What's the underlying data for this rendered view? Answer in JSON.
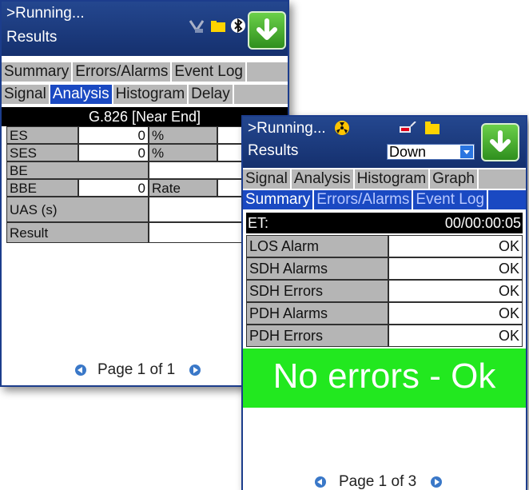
{
  "screen1": {
    "status": ">Running...",
    "title": "Results",
    "tabs_row1": [
      "Summary",
      "Errors/Alarms",
      "Event Log"
    ],
    "tabs_row2": [
      "Signal",
      "Analysis",
      "Histogram",
      "Delay"
    ],
    "active_tab": "Analysis",
    "table_title": "G.826 [Near End]",
    "rows": {
      "es": {
        "label": "ES",
        "value": "0",
        "unit": "%"
      },
      "ses": {
        "label": "SES",
        "value": "0",
        "unit": "%"
      },
      "be": {
        "label": "BE"
      },
      "bbe": {
        "label": "BBE",
        "value": "0",
        "unit": "Rate"
      },
      "uas": {
        "label": "UAS (s)"
      },
      "result": {
        "label": "Result"
      }
    },
    "pager": "Page 1 of 1"
  },
  "screen2": {
    "status": ">Running...",
    "title": "Results",
    "dropdown_value": "Down",
    "tabs_row1": [
      "Signal",
      "Analysis",
      "Histogram",
      "Graph"
    ],
    "tabs_row2": [
      "Summary",
      "Errors/Alarms",
      "Event Log"
    ],
    "active_tab": "Summary",
    "et_label": "ET:",
    "et_value": "00/00:00:05",
    "rows": [
      {
        "label": "LOS Alarm",
        "status": "OK"
      },
      {
        "label": "SDH Alarms",
        "status": "OK"
      },
      {
        "label": "SDH Errors",
        "status": "OK"
      },
      {
        "label": "PDH Alarms",
        "status": "OK"
      },
      {
        "label": "PDH Errors",
        "status": "OK"
      }
    ],
    "verdict": "No errors - Ok",
    "pager": "Page 1 of 3"
  },
  "colors": {
    "header": "#1f3f85",
    "tab_active": "#1a49c2",
    "ok_text": "#16d11b",
    "verdict_bg": "#22e81f",
    "download_button": "#3fb02a"
  }
}
